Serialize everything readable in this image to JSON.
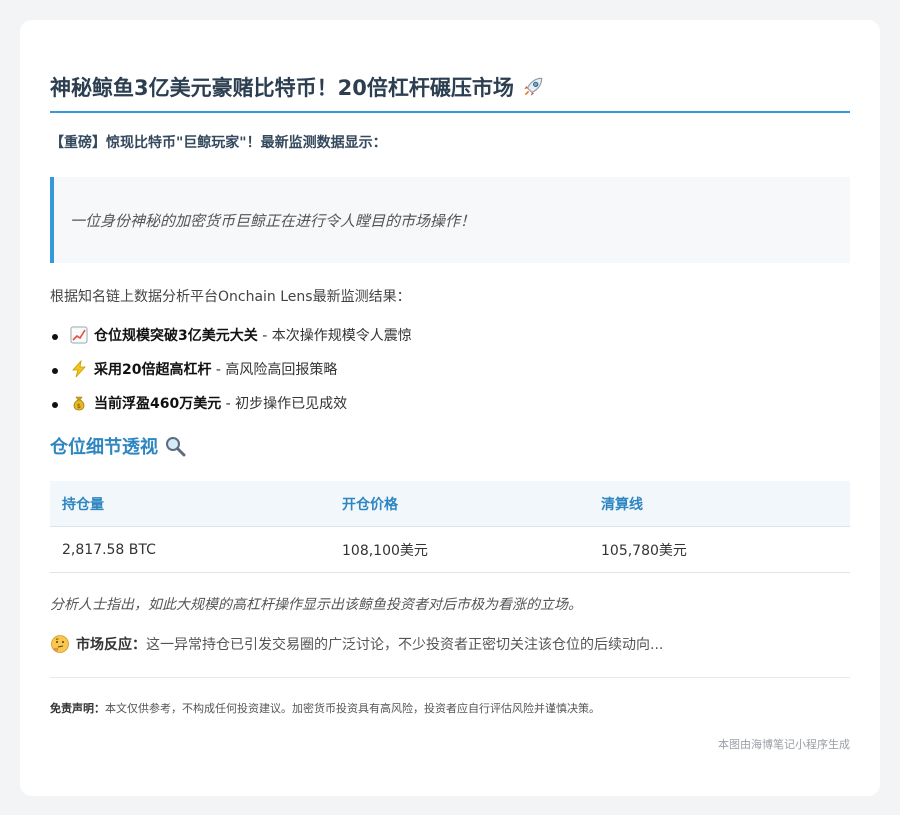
{
  "article": {
    "title": "神秘鲸鱼3亿美元豪赌比特币！20倍杠杆碾压市场",
    "title_icon": "rocket-icon",
    "lead": "【重磅】惊现比特币\"巨鲸玩家\"！最新监测数据显示：",
    "quote": "一位身份神秘的加密货币巨鲸正在进行令人瞠目的市场操作！",
    "intro": "根据知名链上数据分析平台Onchain Lens最新监测结果：",
    "highlights": [
      {
        "icon": "chart-increasing-icon",
        "bold": "仓位规模突破3亿美元大关",
        "rest": " - 本次操作规模令人震惊"
      },
      {
        "icon": "lightning-icon",
        "bold": "采用20倍超高杠杆",
        "rest": " - 高风险高回报策略"
      },
      {
        "icon": "money-bag-icon",
        "bold": "当前浮盈460万美元",
        "rest": " - 初步操作已见成效"
      }
    ],
    "section_title": "仓位细节透视",
    "section_icon": "magnifier-icon",
    "table": {
      "headers": [
        "持仓量",
        "开仓价格",
        "清算线"
      ],
      "rows": [
        [
          "2,817.58 BTC",
          "108,100美元",
          "105,780美元"
        ]
      ]
    },
    "analysis": "分析人士指出，如此大规模的高杠杆操作显示出该鲸鱼投资者对后市极为看涨的立场。",
    "reaction_icon": "thinking-face-icon",
    "reaction_label": "市场反应：",
    "reaction_text": "这一异常持仓已引发交易圈的广泛讨论，不少投资者正密切关注该仓位的后续动向...",
    "disclaimer_label": "免责声明：",
    "disclaimer_text": "本文仅供参考，不构成任何投资建议。加密货币投资具有高风险，投资者应自行评估风险并谨慎决策。",
    "footer": "本图由海博笔记小程序生成"
  },
  "colors": {
    "accent": "#3498db",
    "heading": "#2c3e50",
    "section": "#2e86c1"
  }
}
